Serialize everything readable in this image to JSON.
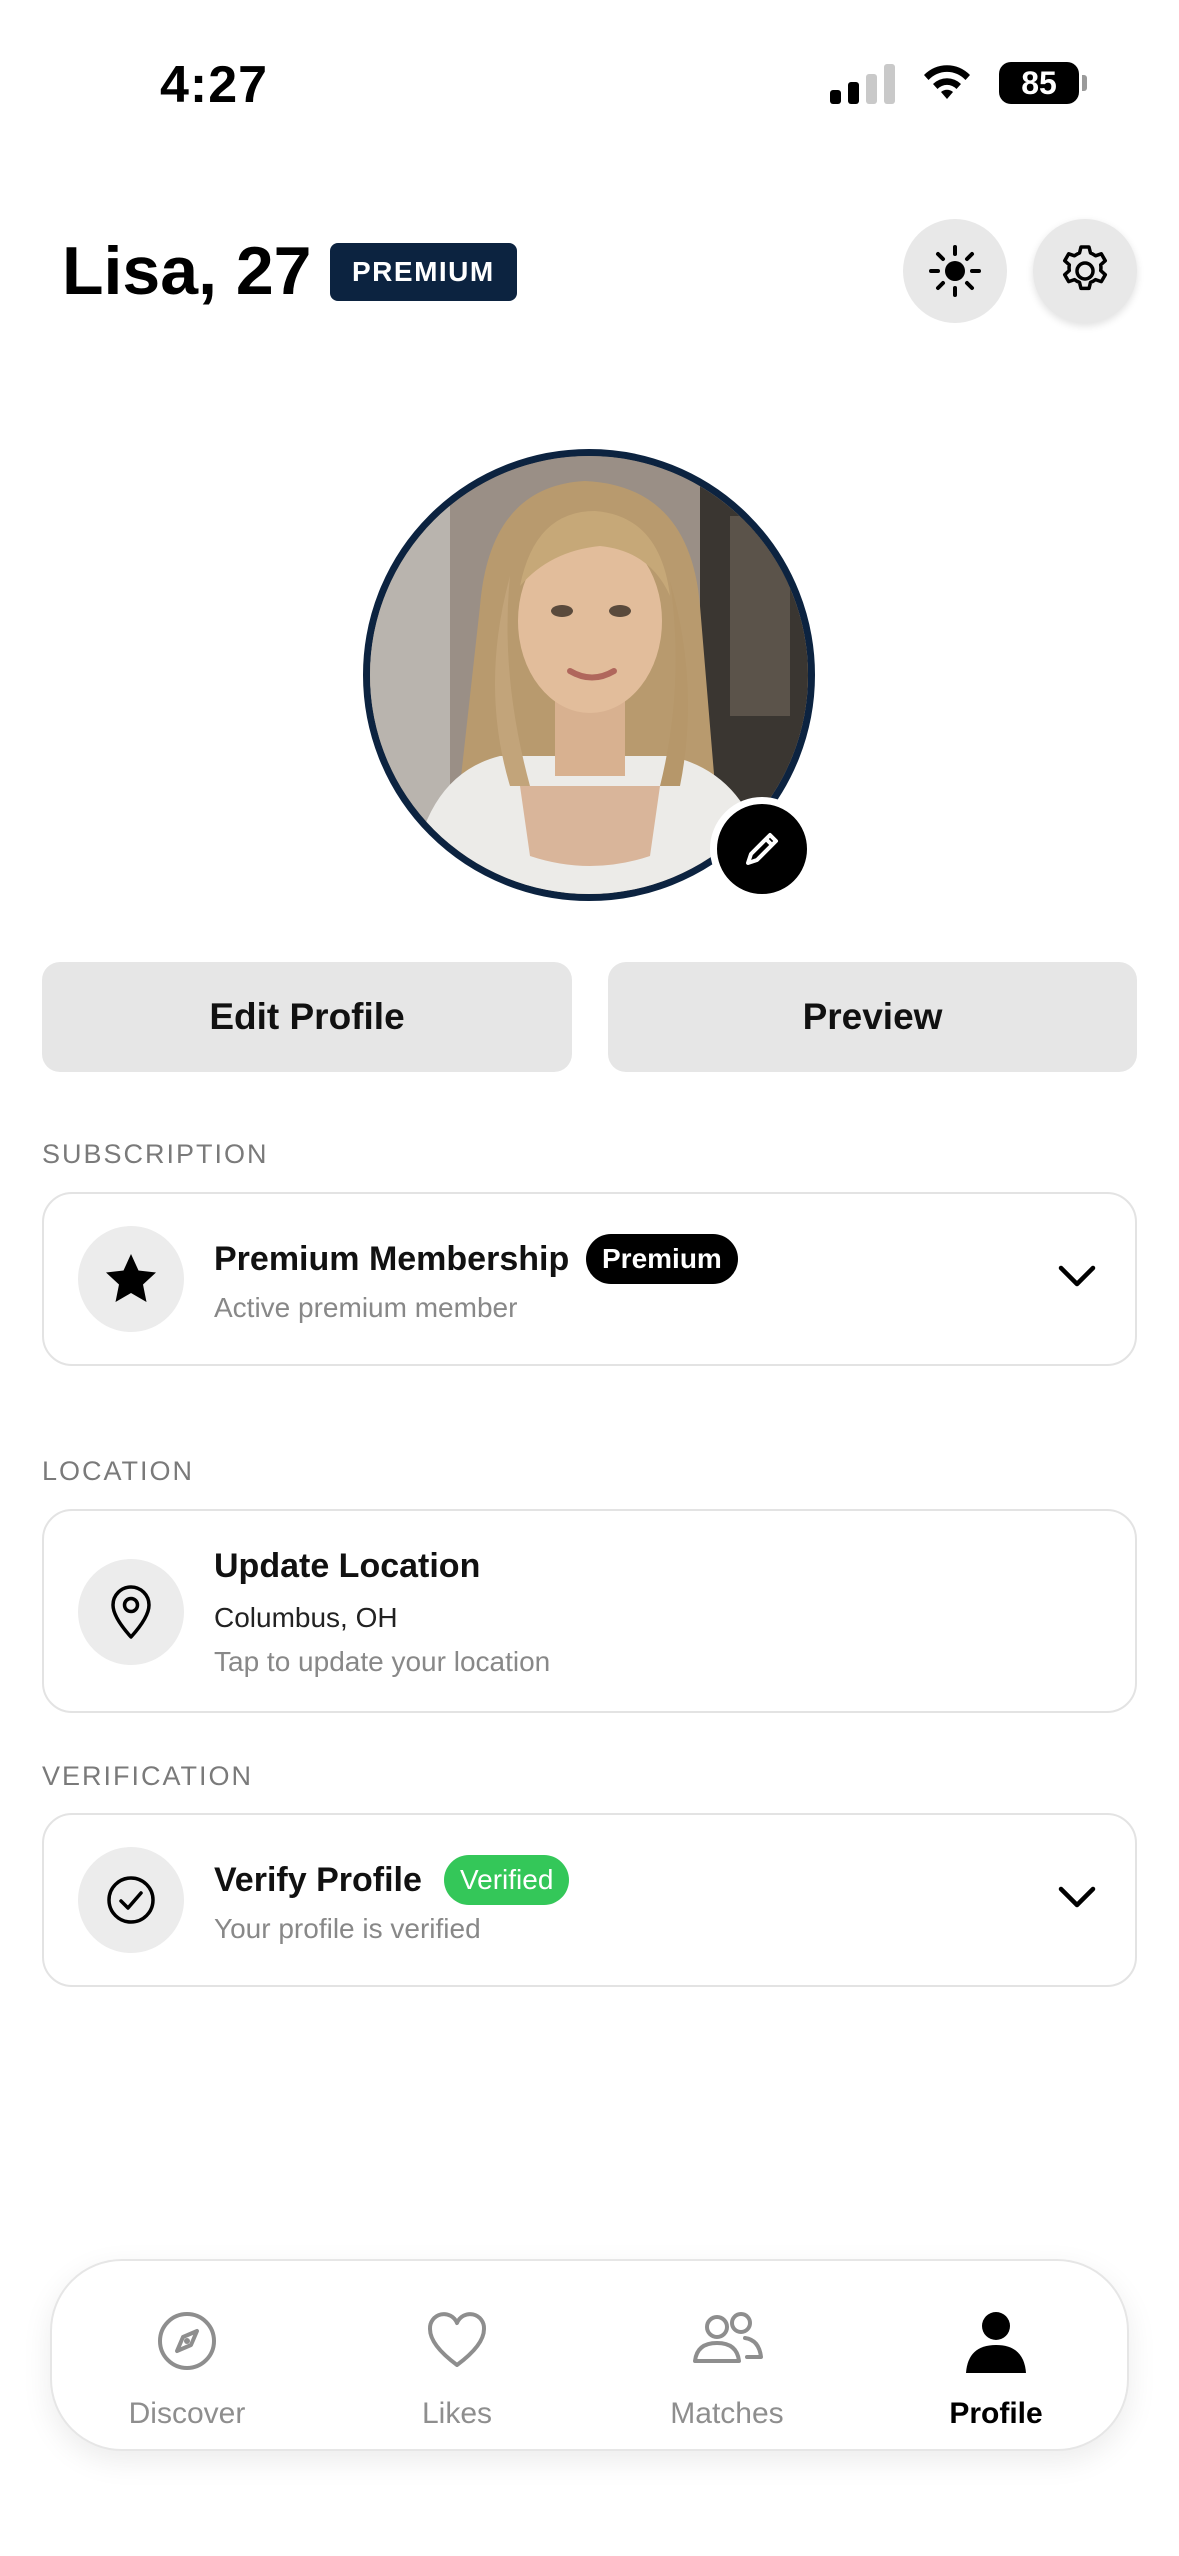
{
  "status_bar": {
    "time": "4:27",
    "battery": "85"
  },
  "header": {
    "name_age": "Lisa, 27",
    "tag": "PREMIUM",
    "theme_icon": "sun-icon",
    "settings_icon": "gear-icon"
  },
  "profile": {
    "avatar": "profile-photo",
    "edit_photo_icon": "pencil-icon"
  },
  "actions": {
    "edit_profile": "Edit Profile",
    "preview": "Preview"
  },
  "subscription": {
    "section_label": "SUBSCRIPTION",
    "title": "Premium Membership",
    "badge": "Premium",
    "subtitle": "Active premium member",
    "icon": "star-icon"
  },
  "location": {
    "section_label": "LOCATION",
    "title": "Update Location",
    "city": "Columbus, OH",
    "hint": "Tap to update your location",
    "icon": "map-pin-icon"
  },
  "verification": {
    "section_label": "VERIFICATION",
    "title": "Verify Profile",
    "badge": "Verified",
    "subtitle": "Your profile is verified",
    "icon": "check-circle-icon"
  },
  "tabbar": {
    "tabs": [
      {
        "label": "Discover",
        "icon": "compass-icon",
        "active": false
      },
      {
        "label": "Likes",
        "icon": "heart-icon",
        "active": false
      },
      {
        "label": "Matches",
        "icon": "people-icon",
        "active": false
      },
      {
        "label": "Profile",
        "icon": "person-icon",
        "active": true
      }
    ]
  },
  "colors": {
    "navy": "#0c2340",
    "verified_green": "#34c759",
    "button_gray": "#e6e6e6"
  }
}
